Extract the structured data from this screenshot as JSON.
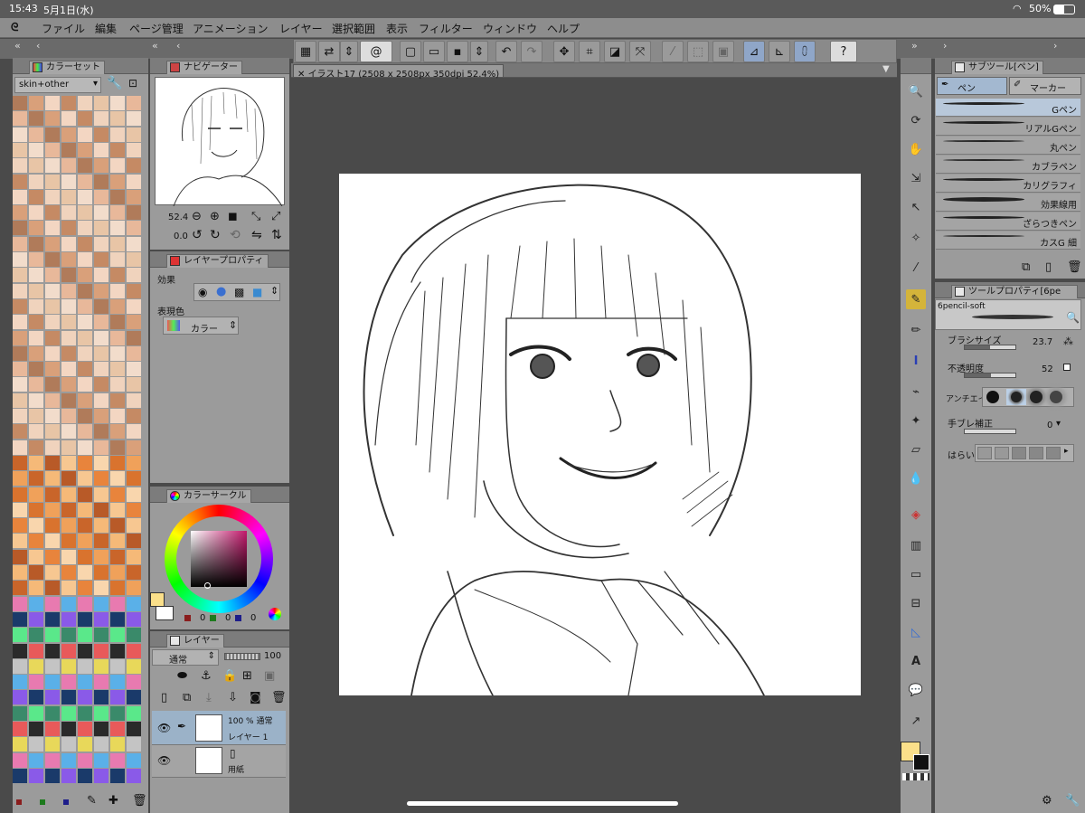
{
  "status": {
    "time": "15:43",
    "date": "5月1日(水)",
    "battery": "50%"
  },
  "menu": [
    "ファイル",
    "編集",
    "ページ管理",
    "アニメーション",
    "レイヤー",
    "選択範囲",
    "表示",
    "フィルター",
    "ウィンドウ",
    "ヘルプ"
  ],
  "colorset": {
    "tab": "カラーセット",
    "selected_set": "skin+other"
  },
  "navigator": {
    "tab": "ナビゲーター",
    "zoom": "52.4",
    "rotation": "0.0"
  },
  "layer_property": {
    "tab": "レイヤープロパティ",
    "effect_label": "効果",
    "color_label": "表現色",
    "color_value": "カラー"
  },
  "color_circle": {
    "tab": "カラーサークル",
    "r": "0",
    "g": "0",
    "b": "0",
    "main_color": "#fbe08a"
  },
  "layers": {
    "tab": "レイヤー",
    "blend": "通常",
    "opacity": "100",
    "items": [
      {
        "line1": "100 % 通常",
        "line2": "レイヤー 1"
      },
      {
        "line1": "",
        "line2": "用紙"
      }
    ]
  },
  "canvas": {
    "tab_title": "イラスト17 (2508 x 2508px 350dpi 52.4%)"
  },
  "subtool": {
    "tab": "サブツール[ペン]",
    "tab_pen": "ペン",
    "tab_marker": "マーカー",
    "brushes": [
      "Gペン",
      "リアルGペン",
      "丸ペン",
      "カブラペン",
      "カリグラフィ",
      "効果線用",
      "ざらつきペン",
      "カスG 細"
    ]
  },
  "toolprop": {
    "tab": "ツールプロパティ[6pe",
    "brush_name": "6pencil-soft",
    "brush_size_label": "ブラシサイズ",
    "brush_size": "23.7",
    "opacity_label": "不透明度",
    "opacity": "52",
    "aa_label": "アンチエイ",
    "stabilize_label": "手ブレ補正",
    "stabilize": "0",
    "harai_label": "はらい"
  }
}
